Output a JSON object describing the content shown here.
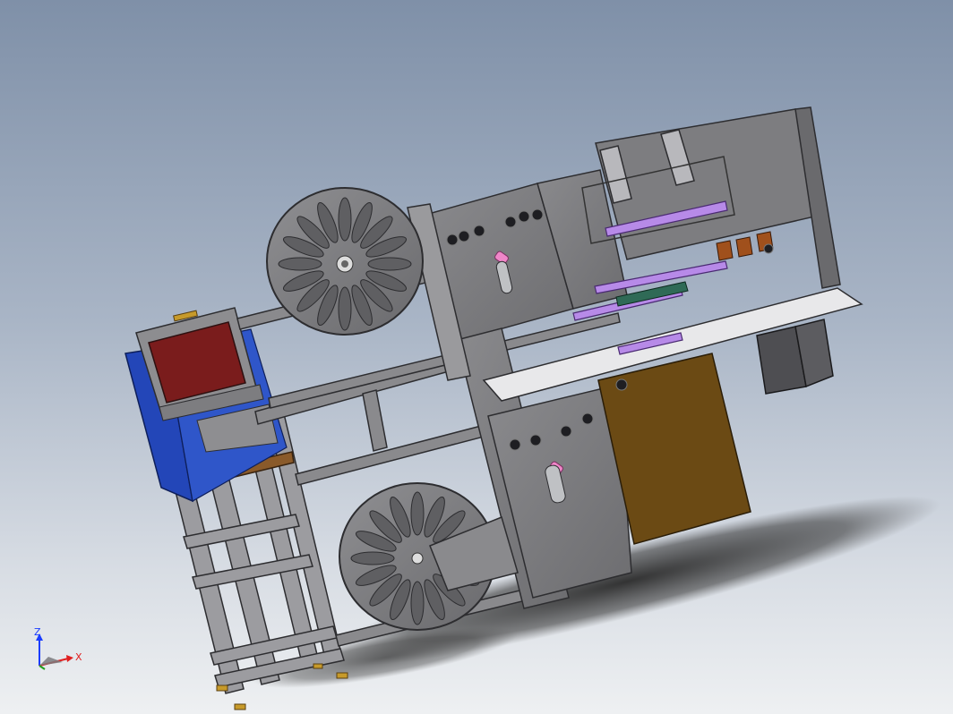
{
  "triad": {
    "z_label": "Z",
    "x_label": "X",
    "z_color": "#1a3cff",
    "x_color": "#e02020",
    "y_color": "#20a020"
  },
  "colors": {
    "steel": "#7d7d80",
    "steel_light": "#a3a3a6",
    "steel_dark": "#4e4e52",
    "frame_blue": "#2346b8",
    "panel_red": "#7a1c1c",
    "wood": "#6b4a14",
    "shelf": "#8a5a2a",
    "pink": "#ef86c8",
    "violet": "#b78ae8",
    "rust": "#a0501c",
    "brass": "#c79a2a"
  }
}
